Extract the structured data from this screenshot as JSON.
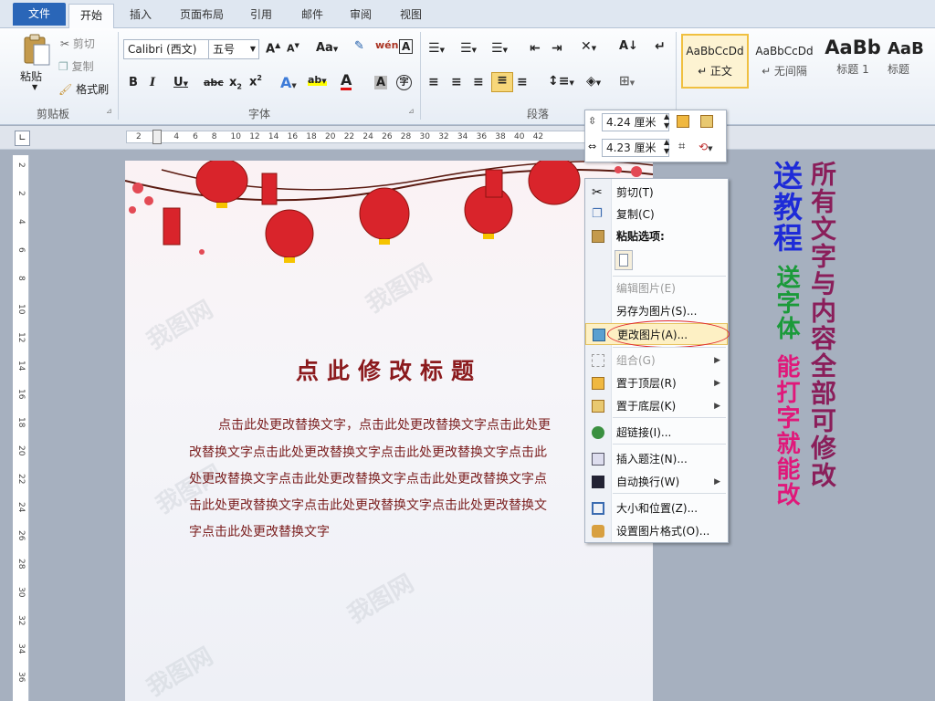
{
  "tabs": {
    "file": "文件",
    "home": "开始",
    "insert": "插入",
    "layout": "页面布局",
    "references": "引用",
    "mailings": "邮件",
    "review": "审阅",
    "view": "视图"
  },
  "clipboard": {
    "paste": "粘贴",
    "cut": "剪切",
    "copy": "复制",
    "format_painter": "格式刷",
    "group_label": "剪贴板"
  },
  "font": {
    "name": "Calibri (西文)",
    "size": "五号",
    "group_label": "字体"
  },
  "paragraph": {
    "group_label": "段落"
  },
  "styles": [
    {
      "preview": "AaBbCcDd",
      "label": "↵ 正文"
    },
    {
      "preview": "AaBbCcDd",
      "label": "↵ 无间隔"
    },
    {
      "preview": "AaBb",
      "label": "标题 1"
    },
    {
      "preview": "AaB",
      "label": "标题"
    }
  ],
  "mini_toolbar": {
    "height": "4.24 厘米",
    "width": "4.23 厘米"
  },
  "hruler_numbers": [
    "2",
    "2",
    "4",
    "6",
    "8",
    "10",
    "12",
    "14",
    "16",
    "18",
    "20",
    "22",
    "24",
    "26",
    "28",
    "30",
    "32",
    "34",
    "36",
    "38",
    "40",
    "42"
  ],
  "vruler_numbers": [
    "2",
    "2",
    "4",
    "6",
    "8",
    "10",
    "12",
    "14",
    "16",
    "18",
    "20",
    "22",
    "24",
    "26",
    "28",
    "30",
    "32",
    "34",
    "36"
  ],
  "document": {
    "title": "点此修改标题",
    "lines": [
      "点击此处更改替换文字，点击此处更改替换文字点击此处更",
      "改替换文字点击此处更改替换文字点击此处更改替换文字点击此",
      "处更改替换文字点击此处更改替换文字点击此处更改替换文字点",
      "击此处更改替换文字点击此处更改替换文字点击此处更改替换文",
      "字点击此处更改替换文字"
    ]
  },
  "context_menu": {
    "cut": "剪切(T)",
    "copy": "复制(C)",
    "paste_options": "粘贴选项:",
    "edit_picture": "编辑图片(E)",
    "save_as_picture": "另存为图片(S)...",
    "change_picture": "更改图片(A)...",
    "group": "组合(G)",
    "bring_front": "置于顶层(R)",
    "send_back": "置于底层(K)",
    "hyperlink": "超链接(I)...",
    "insert_caption": "插入题注(N)...",
    "text_wrap": "自动换行(W)",
    "size_position": "大小和位置(Z)...",
    "format_picture": "设置图片格式(O)..."
  },
  "promo": {
    "tutorial": "送教程",
    "font": "送字体",
    "editable": "能打字就能改",
    "all_editable": "所有文字与内容全部可修改"
  },
  "watermark": "我图网",
  "colors": {
    "accent": "#2a66b8",
    "title_red": "#8b1a1d",
    "promo_blue": "#1e2bd8",
    "promo_green": "#1b9a3a",
    "promo_pink": "#e0187a",
    "promo_purple": "#8a1e5a"
  }
}
